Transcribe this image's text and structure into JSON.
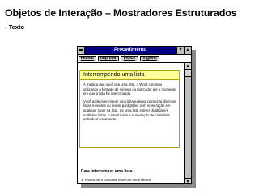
{
  "slide": {
    "title": "Objetos de Interação – Mostradores Estruturados",
    "subtitle": "- Texto"
  },
  "window": {
    "title": "Procedimento",
    "toolbar": [
      {
        "label": "Fechar"
      },
      {
        "label": "Imprimir"
      },
      {
        "label": "Índice"
      },
      {
        "label": "Vigável"
      }
    ]
  },
  "popup": {
    "heading": "Interrompendo uma lista",
    "paragraphs": [
      "À medida que você cria uma lista, o Word continua utilizando o formato de número ou marcador até o momento em que a lista for interrompida.",
      "Você pode interromper uma lista extensa para criar diversas listas menores ou inserir parágrafos sem numeração em qualquer lugar na lista. Se uma lista estiver dividida em múltiplas listas, o Word inicia a numeração de cada lista individual novamente."
    ]
  },
  "content": {
    "section_heading": "Para interromper uma lista",
    "partial_line": "1. Posicione o ponto de inserção onde deseja"
  },
  "colors": {
    "titlebar": "#000080",
    "popup_header": "#ffff99",
    "popup_border": "#b8a000"
  }
}
